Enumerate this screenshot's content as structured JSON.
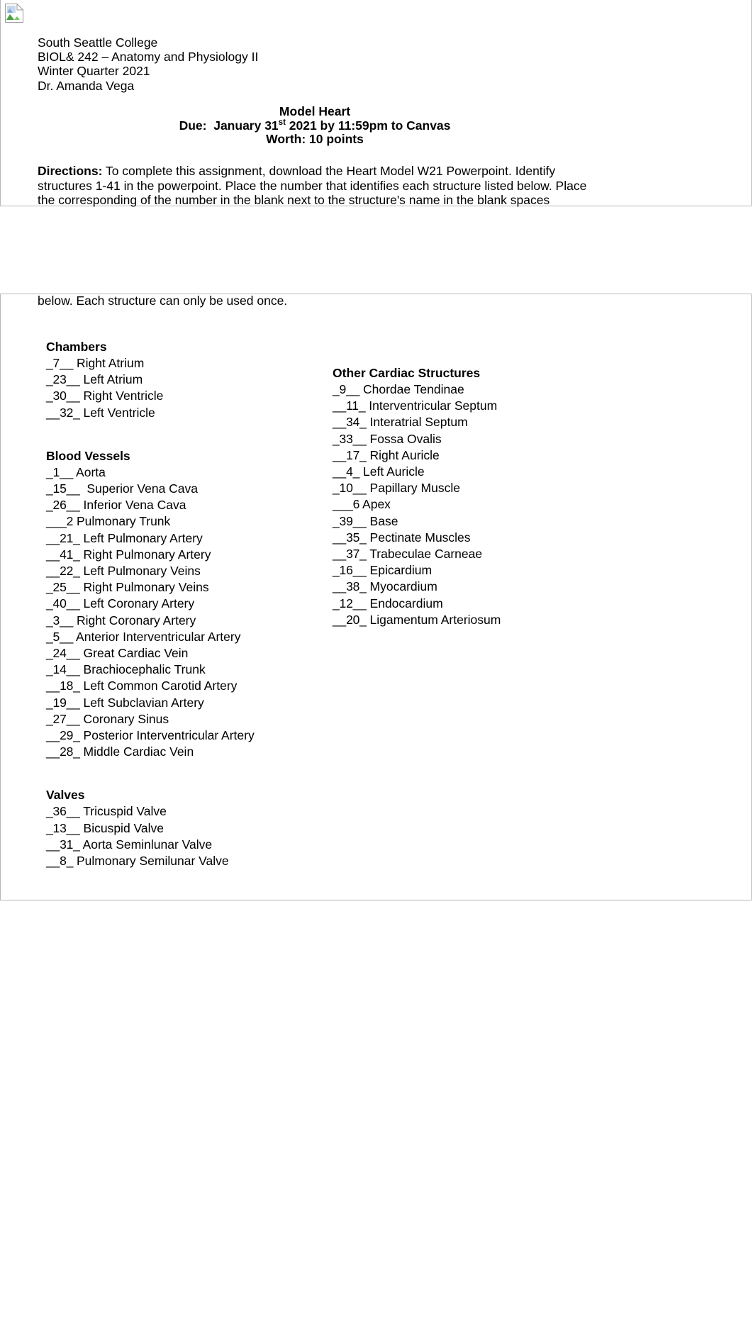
{
  "document": {
    "broken_image_icon": "broken-image-icon",
    "header": {
      "line1": "South Seattle College",
      "line2": "BIOL& 242 – Anatomy and Physiology II",
      "line3": "Winter Quarter 2021",
      "line4": "Dr. Amanda Vega"
    },
    "title": {
      "heading": "Model Heart",
      "due_prefix": "Due:  January 31",
      "due_ordinal": "st",
      "due_suffix": " 2021 by 11:59pm to Canvas",
      "worth": "Worth: 10 points"
    },
    "directions": {
      "label": "Directions:",
      "body": "  To complete this assignment, download the Heart Model W21 Powerpoint. Identify structures 1-41 in the powerpoint. Place the number that identifies each structure listed below.   Place the corresponding of the number in the blank next to the structure's name in the blank spaces",
      "continuation": "below. Each structure can only be used once."
    },
    "columns": {
      "left": [
        {
          "title": "Chambers",
          "entries": [
            {
              "blank": "_7__",
              "label": " Right Atrium"
            },
            {
              "blank": "_23__",
              "label": " Left Atrium"
            },
            {
              "blank": "_30__",
              "label": " Right Ventricle"
            },
            {
              "blank": "__32_",
              "label": " Left Ventricle"
            }
          ]
        },
        {
          "title": "Blood Vessels",
          "entries": [
            {
              "blank": "_1__",
              "label": " Aorta"
            },
            {
              "blank": "_15__",
              "label": "  Superior Vena Cava"
            },
            {
              "blank": "_26__",
              "label": " Inferior Vena Cava"
            },
            {
              "blank": "___2",
              "label": " Pulmonary Trunk"
            },
            {
              "blank": "__21_",
              "label": " Left Pulmonary Artery"
            },
            {
              "blank": "__41_",
              "label": " Right Pulmonary Artery"
            },
            {
              "blank": "__22_",
              "label": " Left Pulmonary Veins"
            },
            {
              "blank": "_25__",
              "label": " Right Pulmonary Veins"
            },
            {
              "blank": "_40__",
              "label": " Left Coronary Artery"
            },
            {
              "blank": "_3__",
              "label": " Right Coronary Artery"
            },
            {
              "blank": "_5__",
              "label": " Anterior Interventricular Artery"
            },
            {
              "blank": "_24__",
              "label": " Great Cardiac Vein"
            },
            {
              "blank": "_14__",
              "label": " Brachiocephalic Trunk"
            },
            {
              "blank": "__18_",
              "label": " Left Common Carotid Artery"
            },
            {
              "blank": "_19__",
              "label": " Left Subclavian Artery"
            },
            {
              "blank": "_27__",
              "label": " Coronary Sinus"
            },
            {
              "blank": "__29_",
              "label": " Posterior Interventricular Artery"
            },
            {
              "blank": "__28_",
              "label": " Middle Cardiac Vein"
            }
          ]
        },
        {
          "title": "Valves",
          "entries": [
            {
              "blank": "_36__",
              "label": " Tricuspid Valve"
            },
            {
              "blank": "_13__",
              "label": " Bicuspid Valve"
            },
            {
              "blank": "__31_",
              "label": " Aorta Seminlunar Valve"
            },
            {
              "blank": "__8_",
              "label": " Pulmonary Semilunar Valve"
            }
          ]
        }
      ],
      "right": [
        {
          "title": "Other Cardiac Structures",
          "entries": [
            {
              "blank": "_9__",
              "label": " Chordae Tendinae"
            },
            {
              "blank": "__11_",
              "label": " Interventricular Septum"
            },
            {
              "blank": "__34_",
              "label": " Interatrial Septum"
            },
            {
              "blank": "_33__",
              "label": " Fossa Ovalis"
            },
            {
              "blank": "__17_",
              "label": " Right Auricle"
            },
            {
              "blank": "__4_",
              "label": " Left Auricle"
            },
            {
              "blank": "_10__",
              "label": " Papillary Muscle"
            },
            {
              "blank": "___6",
              "label": " Apex"
            },
            {
              "blank": "_39__",
              "label": " Base"
            },
            {
              "blank": "__35_",
              "label": " Pectinate Muscles"
            },
            {
              "blank": "__37_",
              "label": " Trabeculae Carneae"
            },
            {
              "blank": "_16__",
              "label": " Epicardium"
            },
            {
              "blank": "__38_",
              "label": " Myocardium"
            },
            {
              "blank": "_12__",
              "label": " Endocardium"
            },
            {
              "blank": "__20_",
              "label": " Ligamentum Arteriosum"
            }
          ]
        }
      ]
    }
  }
}
